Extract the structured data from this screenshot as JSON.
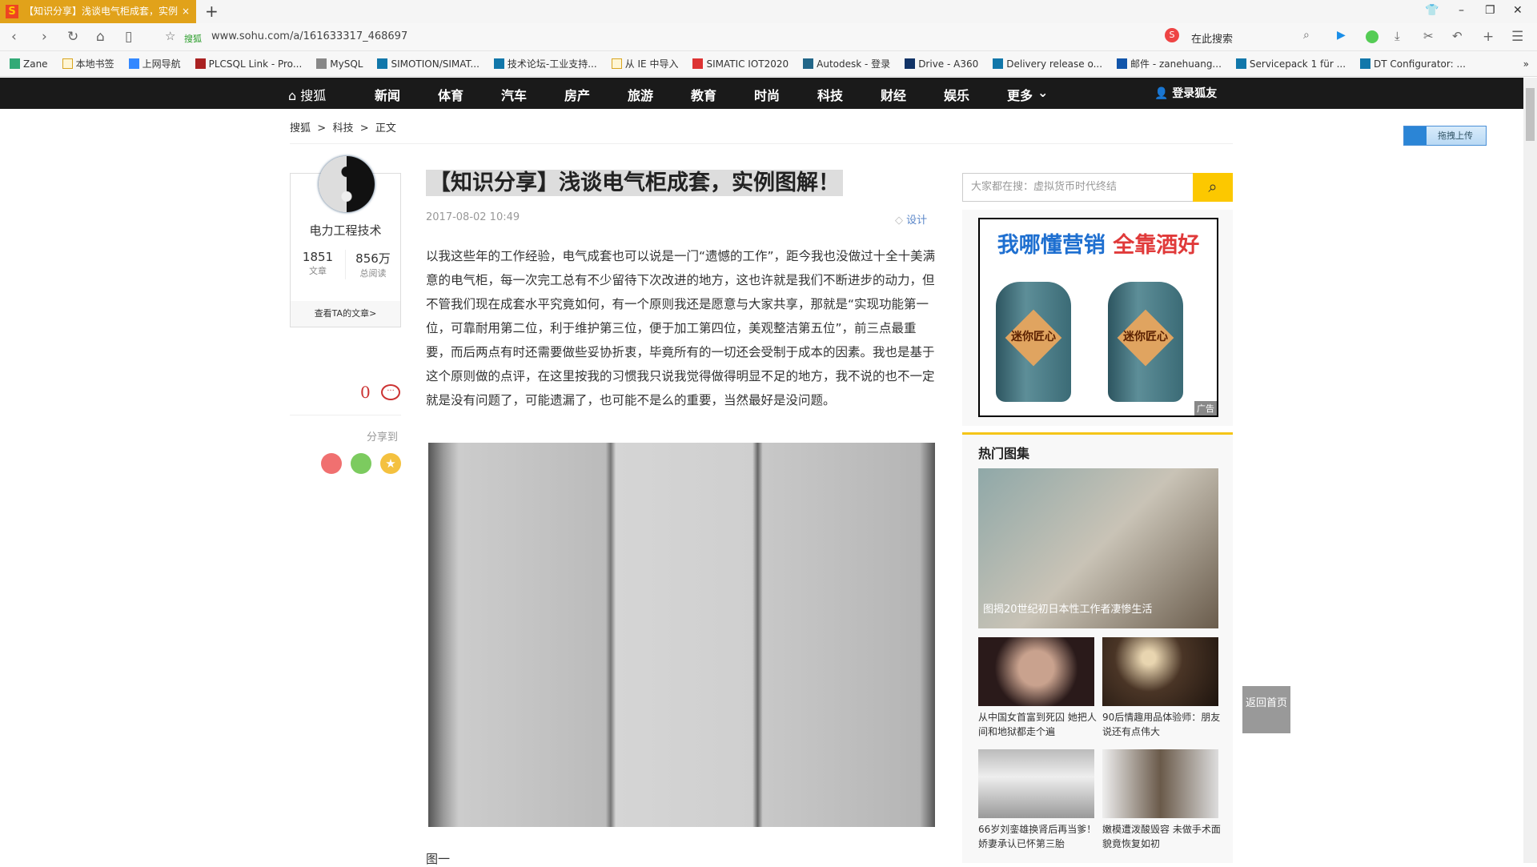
{
  "browser": {
    "tab_title": "【知识分享】浅谈电气柜成套，实例",
    "tab_close": "×",
    "new_tab": "+",
    "url": "www.sohu.com/a/161633317_468697",
    "site_label": "搜狐",
    "search_placeholder": "在此搜索",
    "bookmarks": [
      "Zane",
      "本地书签",
      "上网导航",
      "PLCSQL Link - Pro...",
      "MySQL",
      "SIMOTION/SIMAT...",
      "技术论坛-工业支持...",
      "从 IE 中导入",
      "SIMATIC IOT2020",
      "Autodesk - 登录",
      "Drive - A360",
      "Delivery release o...",
      "邮件 - zanehuang...",
      "Servicepack 1 für ...",
      "DT Configurator: ..."
    ],
    "more": "»"
  },
  "nav": {
    "logo": "搜狐",
    "items": [
      "新闻",
      "体育",
      "汽车",
      "房产",
      "旅游",
      "教育",
      "时尚",
      "科技",
      "财经",
      "娱乐",
      "更多"
    ],
    "login": "登录狐友"
  },
  "breadcrumb": [
    "搜狐",
    ">",
    "科技",
    ">",
    "正文"
  ],
  "author": {
    "name": "电力工程技术",
    "articles": "1851",
    "articles_label": "文章",
    "reads": "856万",
    "reads_label": "总阅读",
    "link": "查看TA的文章>"
  },
  "comments": {
    "count": "0"
  },
  "share": {
    "label": "分享到"
  },
  "article": {
    "title": "【知识分享】浅谈电气柜成套，实例图解！",
    "date": "2017-08-02 10:49",
    "tag": "设计",
    "body": "以我这些年的工作经验，电气成套也可以说是一门“遗憾的工作”，距今我也没做过十全十美满意的电气柜，每一次完工总有不少留待下次改进的地方，这也许就是我们不断进步的动力，但不管我们现在成套水平究竟如何，有一个原则我还是愿意与大家共享，那就是“实现功能第一位，可靠耐用第二位，利于维护第三位，便于加工第四位，美观整洁第五位”，前三点最重要，而后两点有时还需要做些妥协折衷，毕竟所有的一切还会受制于成本的因素。我也是基于这个原则做的点评，在这里按我的习惯我只说我觉得做得明显不足的地方，我不说的也不一定就是没有问题了，可能遗漏了，也可能不是么的重要，当然最好是没问题。",
    "figure_caption": "图一"
  },
  "sidebar": {
    "search_placeholder": "大家都在搜：虚拟货币时代终结",
    "ad": {
      "left": "我哪懂营销",
      "right": "全靠酒好",
      "jar_label": "迷你匠心",
      "tag": "广告"
    },
    "hot": {
      "title": "热门图集",
      "featured": "图揭20世纪初日本性工作者凄惨生活",
      "items": [
        {
          "caption": "从中国女首富到死囚 她把人间和地狱都走个遍"
        },
        {
          "caption": "90后情趣用品体验师：朋友说还有点伟大"
        },
        {
          "caption": "66岁刘銮雄换肾后再当爹！娇妻承认已怀第三胎"
        },
        {
          "caption": "嫩模遭泼酸毁容 未做手术面貌竟恢复如初"
        }
      ]
    }
  },
  "float": {
    "back_home": "返回首页",
    "upload": "拖拽上传"
  },
  "colors": {
    "tab": "#e1a21a",
    "nav": "#1a1a1a",
    "accent": "#fcc800"
  }
}
